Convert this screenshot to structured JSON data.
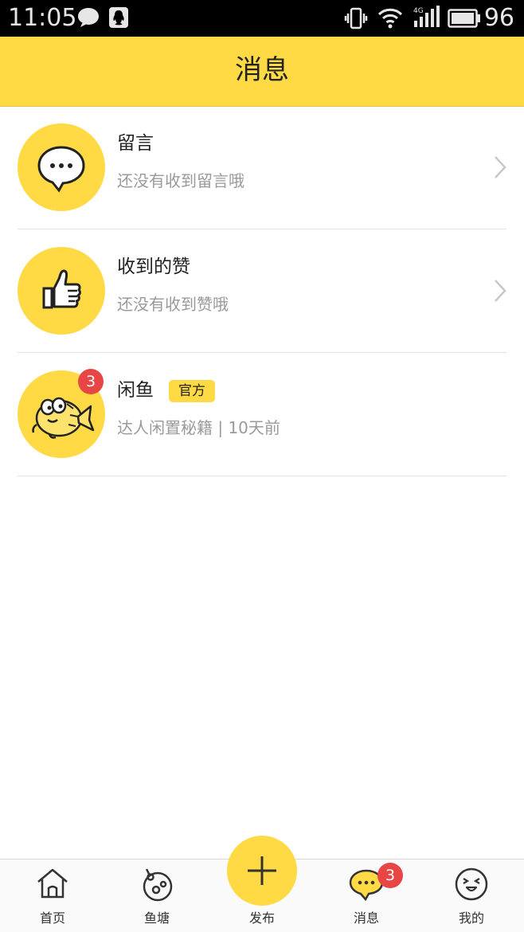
{
  "status_bar": {
    "time": "11:05",
    "battery": "96",
    "network": "4G"
  },
  "header": {
    "title": "消息"
  },
  "messages": [
    {
      "title": "留言",
      "subtitle": "还没有收到留言哦",
      "icon": "speech-bubble-icon"
    },
    {
      "title": "收到的赞",
      "subtitle": "还没有收到赞哦",
      "icon": "thumbs-up-icon"
    },
    {
      "title": "闲鱼",
      "tag": "官方",
      "subtitle": "达人闲置秘籍 | 10天前",
      "badge": "3",
      "icon": "fish-mascot-icon"
    }
  ],
  "tabbar": {
    "items": [
      {
        "label": "首页",
        "icon": "home-icon"
      },
      {
        "label": "鱼塘",
        "icon": "fishpond-icon"
      },
      {
        "label": "发布",
        "icon": "plus-icon"
      },
      {
        "label": "消息",
        "icon": "message-icon",
        "badge": "3"
      },
      {
        "label": "我的",
        "icon": "profile-face-icon"
      }
    ]
  },
  "colors": {
    "accent": "#ffda44",
    "badge": "#e84545",
    "subtext": "#9a9a9a"
  }
}
